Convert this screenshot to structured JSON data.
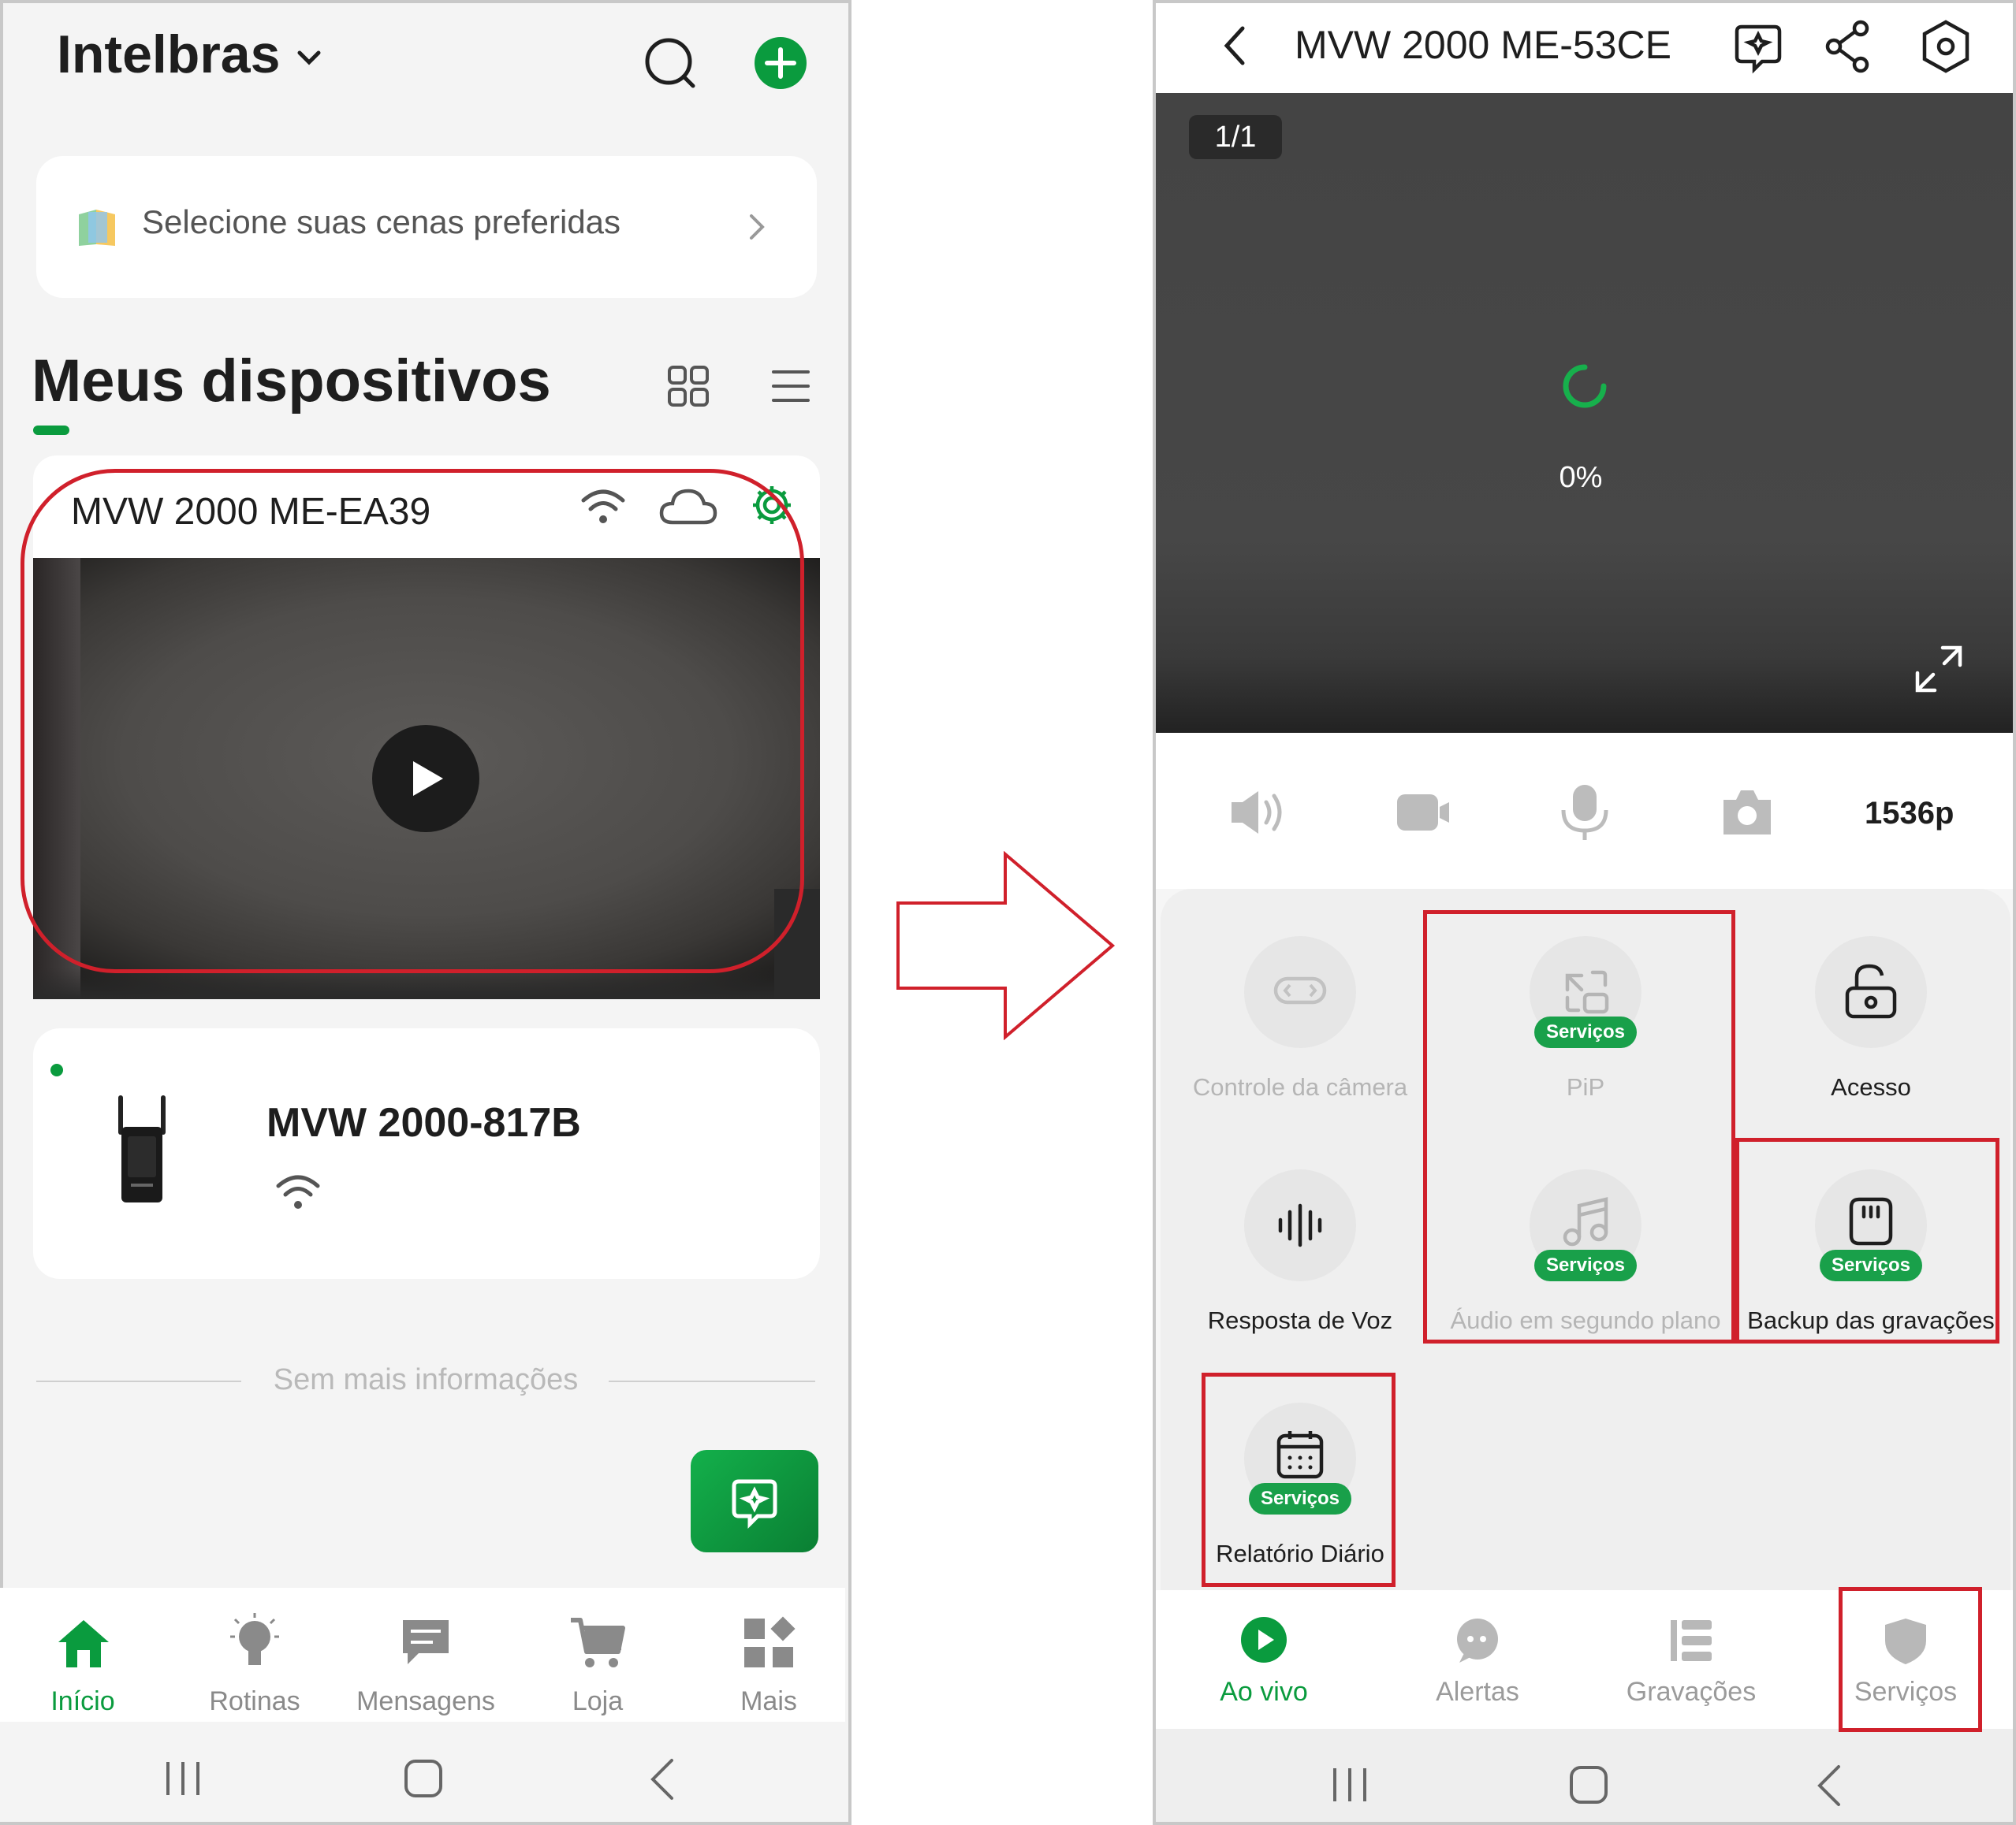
{
  "left_screen": {
    "brand": "Intelbras",
    "scene_banner": "Selecione suas cenas preferidas",
    "section_title": "Meus dispositivos",
    "camera_device": {
      "name": "MVW 2000 ME-EA39"
    },
    "wifi_device": {
      "name": "MVW 2000-817B"
    },
    "no_more_info": "Sem mais informações",
    "nav": [
      {
        "label": "Início"
      },
      {
        "label": "Rotinas"
      },
      {
        "label": "Mensagens"
      },
      {
        "label": "Loja"
      },
      {
        "label": "Mais"
      }
    ]
  },
  "right_screen": {
    "device_title": "MVW 2000 ME-53CE",
    "stream_counter": "1/1",
    "loading_percent": "0%",
    "resolution": "1536p",
    "services": [
      {
        "label": "Controle da câmera"
      },
      {
        "label": "PiP",
        "badge": "Serviços"
      },
      {
        "label": "Acesso"
      },
      {
        "label": "Resposta de Voz"
      },
      {
        "label": "Áudio em segundo plano",
        "badge": "Serviços"
      },
      {
        "label": "Backup das gravações",
        "badge": "Serviços"
      },
      {
        "label": "Relatório Diário",
        "badge": "Serviços"
      }
    ],
    "nav": [
      {
        "label": "Ao vivo"
      },
      {
        "label": "Alertas"
      },
      {
        "label": "Gravações"
      },
      {
        "label": "Serviços"
      }
    ]
  },
  "colors": {
    "accent": "#0a9b3e",
    "highlight": "#d0202b",
    "disabled_text": "#b5b5b5"
  }
}
